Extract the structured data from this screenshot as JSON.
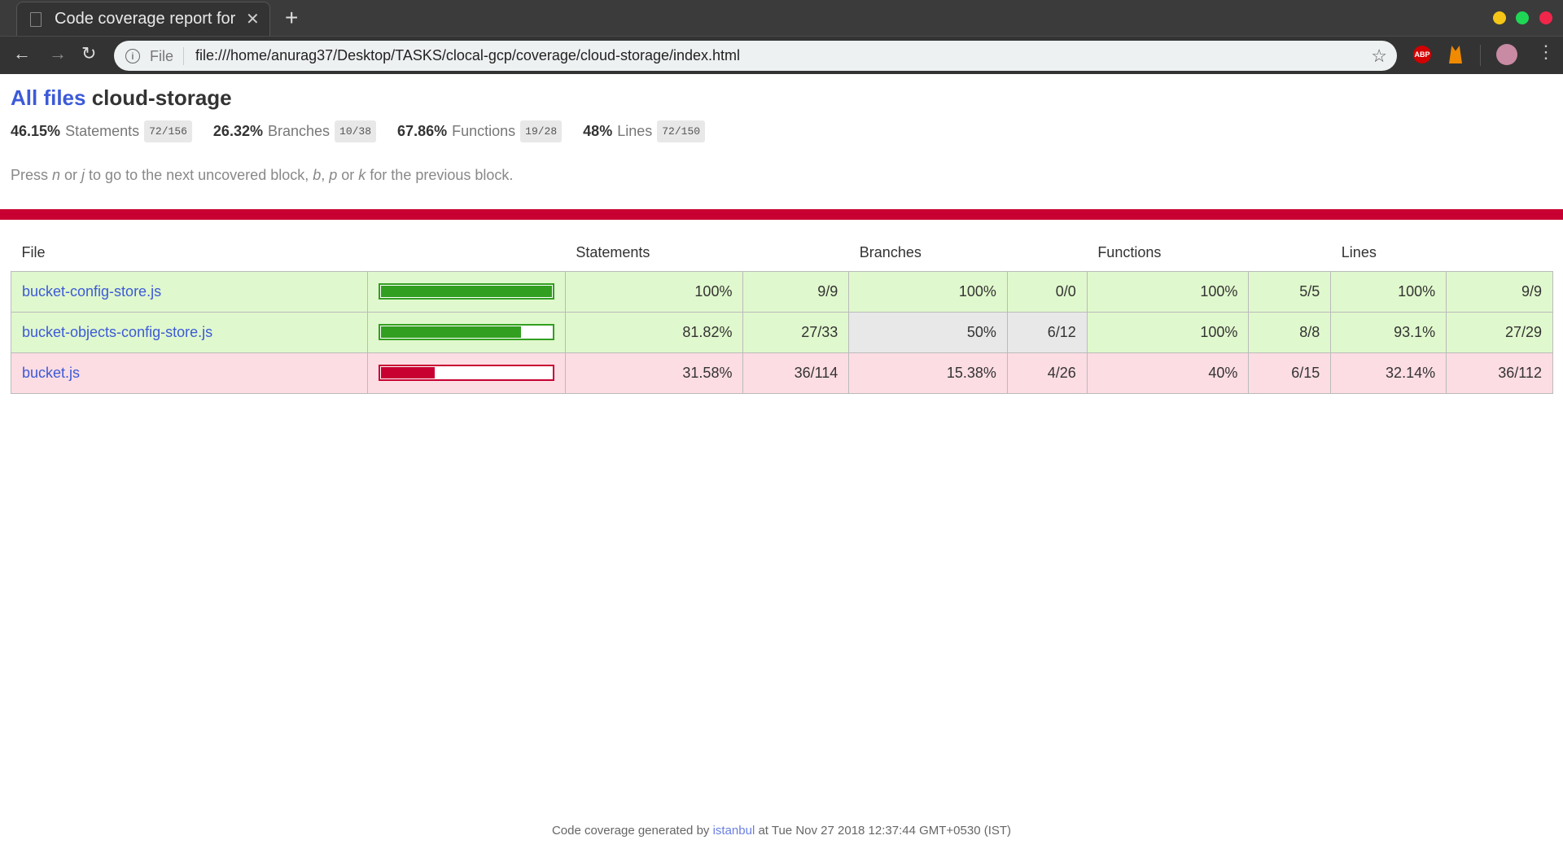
{
  "browser": {
    "tab_title": "Code coverage report for cloud-storage",
    "address_scheme": "File",
    "url": "file:///home/anurag37/Desktop/TASKS/clocal-gcp/coverage/cloud-storage/index.html",
    "abp_label": "ABP"
  },
  "header": {
    "breadcrumb_link": "All files",
    "title": "cloud-storage"
  },
  "summary": [
    {
      "pct": "46.15%",
      "label": "Statements",
      "frac": "72/156"
    },
    {
      "pct": "26.32%",
      "label": "Branches",
      "frac": "10/38"
    },
    {
      "pct": "67.86%",
      "label": "Functions",
      "frac": "19/28"
    },
    {
      "pct": "48%",
      "label": "Lines",
      "frac": "72/150"
    }
  ],
  "hint": {
    "a": "Press ",
    "n": "n",
    "b": " or ",
    "j": "j",
    "c": " to go to the next uncovered block, ",
    "bk": "b",
    "d": ", ",
    "p": "p",
    "e": " or ",
    "k": "k",
    "f": " for the previous block."
  },
  "table": {
    "headers": {
      "file": "File",
      "statements": "Statements",
      "branches": "Branches",
      "functions": "Functions",
      "lines": "Lines"
    },
    "rows": [
      {
        "file": "bucket-config-store.js",
        "level": "high",
        "bar_pct": 100,
        "stmt_pct": "100%",
        "stmt": "9/9",
        "br_pct": "100%",
        "br": "0/0",
        "br_level": "high",
        "fn_pct": "100%",
        "fn": "5/5",
        "ln_pct": "100%",
        "ln": "9/9"
      },
      {
        "file": "bucket-objects-config-store.js",
        "level": "high",
        "bar_pct": 81.82,
        "stmt_pct": "81.82%",
        "stmt": "27/33",
        "br_pct": "50%",
        "br": "6/12",
        "br_level": "medium",
        "fn_pct": "100%",
        "fn": "8/8",
        "ln_pct": "93.1%",
        "ln": "27/29"
      },
      {
        "file": "bucket.js",
        "level": "low",
        "bar_pct": 31.58,
        "stmt_pct": "31.58%",
        "stmt": "36/114",
        "br_pct": "15.38%",
        "br": "4/26",
        "br_level": "low",
        "fn_pct": "40%",
        "fn": "6/15",
        "ln_pct": "32.14%",
        "ln": "36/112"
      }
    ]
  },
  "footer": {
    "prefix": "Code coverage generated by ",
    "link": "istanbul",
    "suffix": " at Tue Nov 27 2018 12:37:44 GMT+0530 (IST)"
  },
  "colors": {
    "high": "#339f21",
    "low": "#c80032",
    "accent": "#3c5ad8"
  }
}
